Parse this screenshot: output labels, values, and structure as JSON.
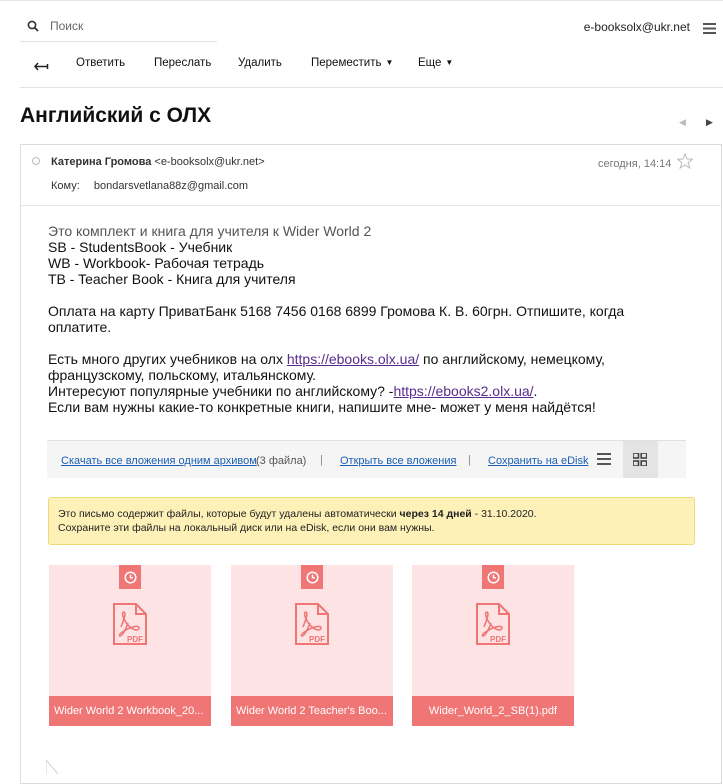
{
  "search": {
    "placeholder": "Поиск"
  },
  "account": {
    "email": "e-booksolx@ukr.net"
  },
  "toolbar": {
    "reply": "Ответить",
    "forward": "Переслать",
    "delete": "Удалить",
    "move": "Переместить",
    "more": "Еще"
  },
  "message": {
    "subject": "Английский с ОЛХ",
    "sender_name": "Катерина Громова",
    "sender_email": "<e-booksolx@ukr.net>",
    "date": "сегодня, 14:14",
    "to_label": "Кому:",
    "to_value": "bondarsvetlana88z@gmail.com",
    "body": {
      "line1": "Это комплект и книга для учителя к Wider World 2",
      "line2": "SB - StudentsBook - Учебник",
      "line3": "WB - Workbook- Рабочая тетрадь",
      "line4": "TB - Teacher Book - Книга для учителя",
      "line5": "Оплата на карту ПриватБанк 5168 7456 0168 6899 Громова К. В. 60грн. Отпишите, когда оплатите.",
      "line6_pre": "Есть много других учебников на олх ",
      "line6_link": "https://ebooks.olx.ua/",
      "line6_post": " по английскому, немецкому, французскому, польскому, итальянскому.",
      "line7_pre": "Интересуют популярные учебники по английскому? -",
      "line7_link": "https://ebooks2.olx.ua/",
      "line7_post": ".",
      "line8": "Если вам нужны какие-то конкретные книги, напишите мне- может у меня найдётся!"
    }
  },
  "attachments_bar": {
    "download_all": "Скачать все вложения одним архивом",
    "count": "(3 файла)",
    "sep": "|",
    "open_all": "Открыть все вложения",
    "save_edisk": "Сохранить на eDisk"
  },
  "warning": {
    "text1": "Это письмо содержит файлы, которые будут удалены автоматически ",
    "text_bold": "через 14 дней",
    "text2": " - 31.10.2020.",
    "line2": "Сохраните эти файлы на локальный диск или на eDisk, если они вам нужны."
  },
  "files": [
    {
      "name": "Wider World 2 Workbook_20...",
      "icon": "pdf-icon"
    },
    {
      "name": "Wider World 2 Teacher's Boo...",
      "icon": "pdf-icon"
    },
    {
      "name": "Wider_World_2_SB(1).pdf",
      "icon": "pdf-icon"
    }
  ],
  "colors": {
    "accent_red": "#f07575",
    "file_bg": "#fde3e3",
    "warning_bg": "#fdf1b8",
    "link_blue": "#1a5fb4",
    "link_visited": "#5a2a8c"
  }
}
